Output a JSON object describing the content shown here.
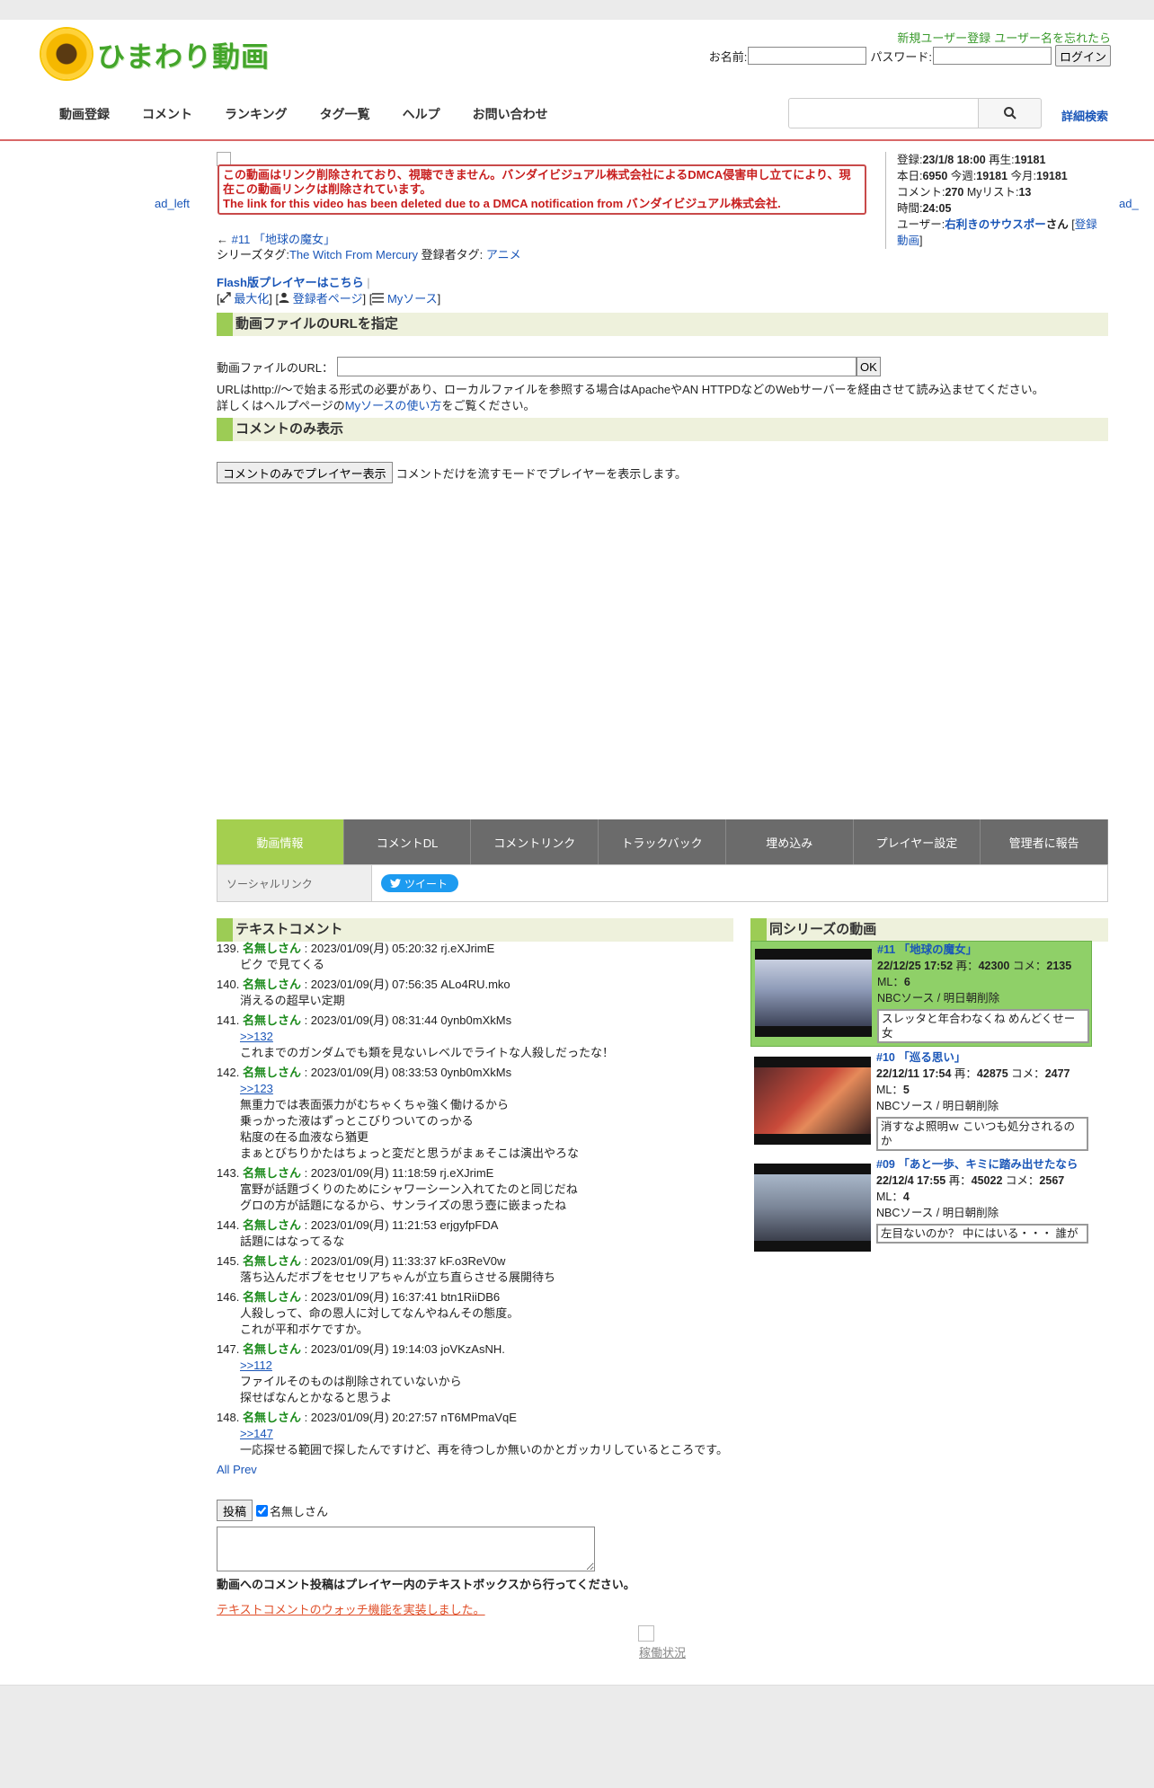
{
  "header": {
    "logo_text": "ひまわり動画",
    "link_register": "新規ユーザー登録",
    "link_forgot": "ユーザー名を忘れたら",
    "name_label": "お名前:",
    "password_label": "パスワード:",
    "login_button": "ログイン"
  },
  "nav": {
    "items": [
      "動画登録",
      "コメント",
      "ランキング",
      "タグ一覧",
      "ヘルプ",
      "お問い合わせ"
    ],
    "search_placeholder": "",
    "advanced": "詳細検索"
  },
  "ads": {
    "left": "ad_left",
    "right": "ad_"
  },
  "video": {
    "dmca_jp": "この動画はリンク削除されており、視聴できません。バンダイビジュアル株式会社によるDMCA侵害申し立てにより、現在この動画リンクは削除されています。",
    "dmca_en": "The link for this video has been deleted due to a DMCA notification from バンダイビジュアル株式会社.",
    "prev_arrow": "←",
    "episode_link": "#11 「地球の魔女」",
    "series_tag_label": "シリーズタグ:",
    "series_tag": "The Witch From Mercury",
    "reg_tag_label": "登録者タグ:",
    "reg_tag": "アニメ",
    "flash_link": "Flash版プレイヤーはこちら",
    "maximize": "最大化",
    "uploader_page": "登録者ページ",
    "my_source": "Myソース"
  },
  "stats": {
    "registered_label": "登録:",
    "registered": "23/1/8 18:00",
    "plays_label": "再生:",
    "plays": "19181",
    "today_label": "本日:",
    "today": "6950",
    "week_label": "今週:",
    "week": "19181",
    "month_label": "今月:",
    "month": "19181",
    "comments_label": "コメント:",
    "comments": "270",
    "mylist_label": "Myリスト:",
    "mylist": "13",
    "duration_label": "時間:",
    "duration": "24:05",
    "user_label": "ユーザー:",
    "user": "右利きのサウスポー",
    "user_suffix": "さん",
    "user_videos": "登録動画"
  },
  "url_section": {
    "title": "動画ファイルのURLを指定",
    "label": "動画ファイルのURL：",
    "ok": "OK",
    "note1": "URLはhttp://～で始まる形式の必要があり、ローカルファイルを参照する場合はApacheやAN HTTPDなどのWebサーバーを経由させて読み込ませてください。",
    "note2_pre": "詳しくはヘルプページの",
    "note2_link": "Myソースの使い方",
    "note2_post": "をご覧ください。"
  },
  "comment_only": {
    "title": "コメントのみ表示",
    "button": "コメントのみでプレイヤー表示",
    "desc": "コメントだけを流すモードでプレイヤーを表示します。"
  },
  "tabs": [
    "動画情報",
    "コメントDL",
    "コメントリンク",
    "トラックバック",
    "埋め込み",
    "プレイヤー設定",
    "管理者に報告"
  ],
  "social": {
    "label": "ソーシャルリンク",
    "tweet": "ツイート"
  },
  "text_comments": {
    "title": "テキストコメント",
    "items": [
      {
        "num": "139.",
        "name": "名無しさん",
        "meta": ": 2023/01/09(月) 05:20:32 rj.eXJrimE",
        "anchor": "",
        "lines": [
          "ビク で見てくる"
        ]
      },
      {
        "num": "140.",
        "name": "名無しさん",
        "meta": ": 2023/01/09(月) 07:56:35 ALo4RU.mko",
        "anchor": "",
        "lines": [
          "消えるの超早い定期"
        ]
      },
      {
        "num": "141.",
        "name": "名無しさん",
        "meta": ": 2023/01/09(月) 08:31:44 0ynb0mXkMs",
        "anchor": ">>132",
        "lines": [
          "これまでのガンダムでも類を見ないレベルでライトな人殺しだったな！"
        ]
      },
      {
        "num": "142.",
        "name": "名無しさん",
        "meta": ": 2023/01/09(月) 08:33:53 0ynb0mXkMs",
        "anchor": ">>123",
        "lines": [
          "無重力では表面張力がむちゃくちゃ強く働けるから",
          "乗っかった液はずっとこびりついてのっかる",
          "粘度の在る血液なら猶更",
          "まぁとびちりかたはちょっと変だと思うがまぁそこは演出やろな"
        ]
      },
      {
        "num": "143.",
        "name": "名無しさん",
        "meta": ": 2023/01/09(月) 11:18:59 rj.eXJrimE",
        "anchor": "",
        "lines": [
          "富野が話題づくりのためにシャワーシーン入れてたのと同じだね",
          "グロの方が話題になるから、サンライズの思う壺に嵌まったね"
        ]
      },
      {
        "num": "144.",
        "name": "名無しさん",
        "meta": ": 2023/01/09(月) 11:21:53 erjgyfpFDA",
        "anchor": "",
        "lines": [
          "話題にはなってるな"
        ]
      },
      {
        "num": "145.",
        "name": "名無しさん",
        "meta": ": 2023/01/09(月) 11:33:37 kF.o3ReV0w",
        "anchor": "",
        "lines": [
          "落ち込んだボブをセセリアちゃんが立ち直らさせる展開待ち"
        ]
      },
      {
        "num": "146.",
        "name": "名無しさん",
        "meta": ": 2023/01/09(月) 16:37:41 btn1RiiDB6",
        "anchor": "",
        "lines": [
          "人殺しって、命の恩人に対してなんやねんその態度。",
          "これが平和ボケですか。"
        ]
      },
      {
        "num": "147.",
        "name": "名無しさん",
        "meta": ": 2023/01/09(月) 19:14:03 joVKzAsNH.",
        "anchor": ">>112",
        "lines": [
          "ファイルそのものは削除されていないから",
          "探せばなんとかなると思うよ"
        ]
      },
      {
        "num": "148.",
        "name": "名無しさん",
        "meta": ": 2023/01/09(月) 20:27:57 nT6MPmaVqE",
        "anchor": ">>147",
        "lines": [
          "一応探せる範囲で探したんですけど、再を待つしか無いのかとガッカリしているところです。"
        ]
      }
    ],
    "all_link": "All",
    "prev_link": "Prev",
    "post_button": "投稿",
    "anon_label": "名無しさん",
    "warning": "動画へのコメント投稿はプレイヤー内のテキストボックスから行ってください。",
    "watch_link": "テキストコメントのウォッチ機能を実装しました。"
  },
  "same_series": {
    "title": "同シリーズの動画",
    "items": [
      {
        "title": "#11 「地球の魔女」",
        "date": "22/12/25 17:52",
        "plays_label": "再：",
        "plays": "42300",
        "comments_label": "コメ：",
        "comments": "2135",
        "ml_label": "ML：",
        "ml": "6",
        "source": "NBCソース / 明日朝削除",
        "latest": "スレッタと年合わなくね めんどくせー女",
        "highlight": true
      },
      {
        "title": "#10 「巡る思い」",
        "date": "22/12/11 17:54",
        "plays_label": "再：",
        "plays": "42875",
        "comments_label": "コメ：",
        "comments": "2477",
        "ml_label": "ML：",
        "ml": "5",
        "source": "NBCソース / 明日朝削除",
        "latest": "消すなよ照明ｗ こいつも処分されるのか",
        "highlight": false
      },
      {
        "title": "#09 「あと一歩、キミに踏み出せたなら",
        "date": "22/12/4 17:55",
        "plays_label": "再：",
        "plays": "45022",
        "comments_label": "コメ：",
        "comments": "2567",
        "ml_label": "ML：",
        "ml": "4",
        "source": "NBCソース / 明日朝削除",
        "latest": "左目ないのか？ 中にはいる・・・ 誰が",
        "highlight": false
      }
    ]
  },
  "footer": {
    "status_link": "稼働状況"
  }
}
